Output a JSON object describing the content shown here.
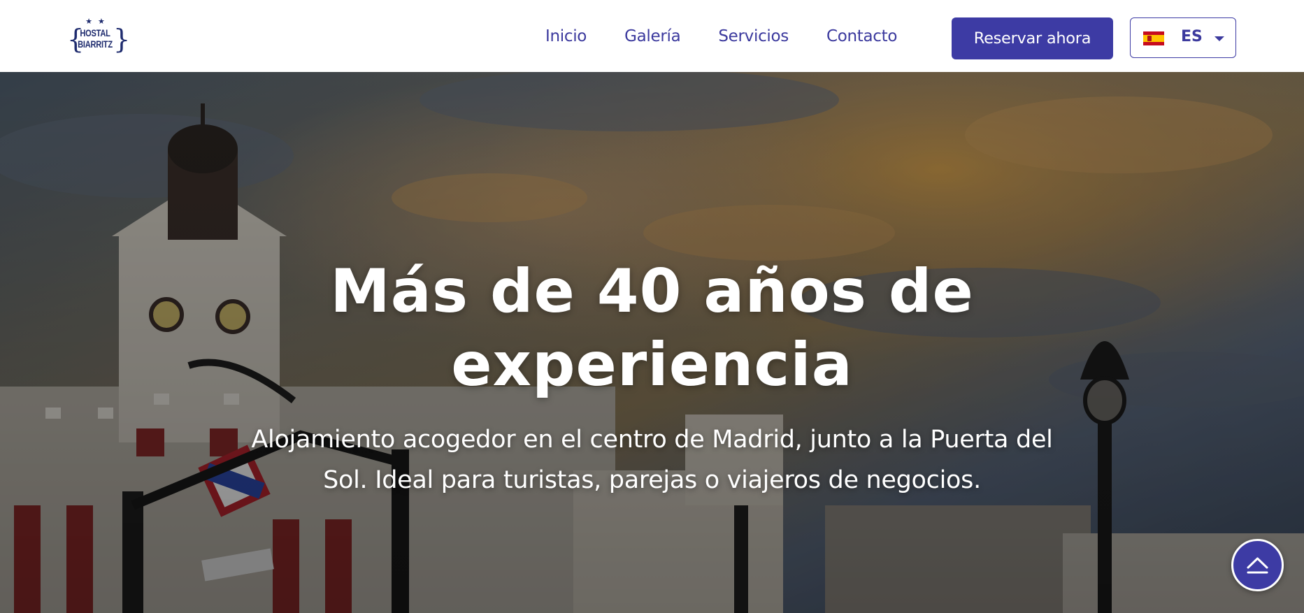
{
  "brand": {
    "logo_line1": "HOSTAL",
    "logo_line2": "BIARRITZ",
    "logo_stars": "★★",
    "primary_color": "#3d3ba4",
    "logo_color": "#1e2b6e"
  },
  "nav": {
    "items": [
      {
        "label": "Inicio"
      },
      {
        "label": "Galería"
      },
      {
        "label": "Servicios"
      },
      {
        "label": "Contacto"
      }
    ],
    "book_label": "Reservar ahora",
    "language": {
      "code": "ES",
      "flag": "spain-flag-icon"
    }
  },
  "hero": {
    "title_line1": "Más de 40 años de",
    "title_line2": "experiencia",
    "subtitle_line1": "Alojamiento acogedor en el centro de Madrid, junto a la Puerta del",
    "subtitle_line2": "Sol. Ideal para turistas, parejas o viajeros de negocios."
  },
  "scroll_top": {
    "icon": "chevron-up-icon"
  }
}
